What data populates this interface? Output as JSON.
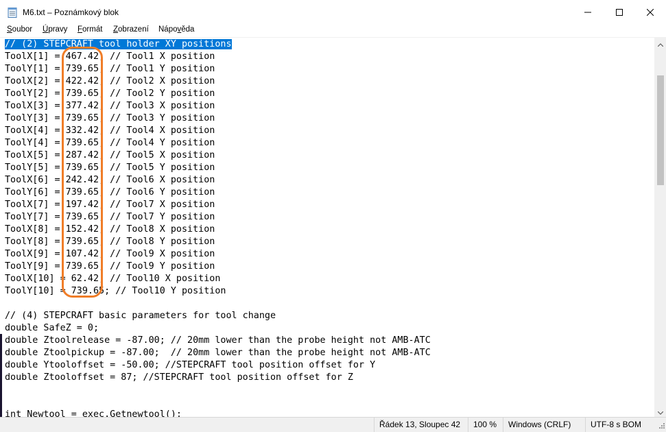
{
  "window": {
    "title": "M6.txt – Poznámkový blok",
    "app_icon": "notepad-icon",
    "controls": [
      "minimize-icon",
      "maximize-icon",
      "close-icon"
    ]
  },
  "menu": {
    "items": [
      {
        "hotkey": "S",
        "rest": "oubor"
      },
      {
        "hotkey": "Ú",
        "rest": "pravy"
      },
      {
        "hotkey": "F",
        "rest": "ormát"
      },
      {
        "hotkey": "Z",
        "rest": "obrazení"
      },
      {
        "pre": "Nápo",
        "hotkey": "v",
        "rest": "ěda"
      }
    ]
  },
  "editor": {
    "lines": [
      "// (2) STEPCRAFT tool holder XY positions",
      "ToolX[1] = 467.42; // Tool1 X position",
      "ToolY[1] = 739.65; // Tool1 Y position",
      "ToolX[2] = 422.42; // Tool2 X position",
      "ToolY[2] = 739.65; // Tool2 Y position",
      "ToolX[3] = 377.42; // Tool3 X position",
      "ToolY[3] = 739.65; // Tool3 Y position",
      "ToolX[4] = 332.42; // Tool4 X position",
      "ToolY[4] = 739.65; // Tool4 Y position",
      "ToolX[5] = 287.42; // Tool5 X position",
      "ToolY[5] = 739.65; // Tool5 Y position",
      "ToolX[6] = 242.42; // Tool6 X position",
      "ToolY[6] = 739.65; // Tool6 Y position",
      "ToolX[7] = 197.42; // Tool7 X position",
      "ToolY[7] = 739.65; // Tool7 Y position",
      "ToolX[8] = 152.42; // Tool8 X position",
      "ToolY[8] = 739.65; // Tool8 Y position",
      "ToolX[9] = 107.42; // Tool9 X position",
      "ToolY[9] = 739.65; // Tool9 Y position",
      "ToolX[10] = 62.42; // Tool10 X position",
      "ToolY[10] = 739.65; // Tool10 Y position",
      "",
      "// (4) STEPCRAFT basic parameters for tool change",
      "double SafeZ = 0;",
      "double Ztoolrelease = -87.00; // 20mm lower than the probe height not AMB-ATC",
      "double Ztoolpickup = -87.00;  // 20mm lower than the probe height not AMB-ATC",
      "double Ytooloffset = -50.00; //STEPCRAFT tool position offset for Y",
      "double Ztooloffset = 87; //STEPCRAFT tool position offset for Z",
      "",
      "",
      "int Newtool = exec.Getnewtool();"
    ],
    "selected_line_index": 0,
    "highlight_color": "#0078d7",
    "annotation_color": "#f07d28"
  },
  "statusbar": {
    "position": "Řádek 13, Sloupec 42",
    "zoom": "100 %",
    "line_endings": "Windows (CRLF)",
    "encoding": "UTF-8 s BOM"
  }
}
